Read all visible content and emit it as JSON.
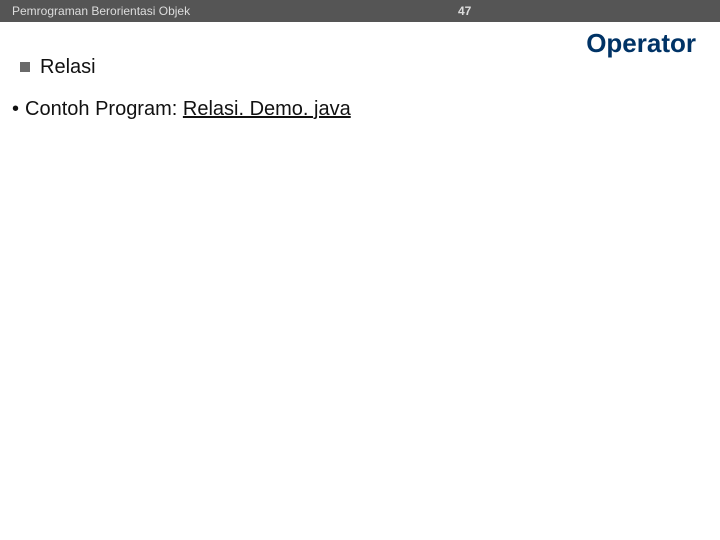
{
  "topbar": {
    "left": "Pemrograman Berorientasi Objek",
    "number": "47"
  },
  "title": "Operator",
  "subheading": "Relasi",
  "body": {
    "prefix": "Contoh Program: ",
    "link_text": "Relasi. Demo. java"
  }
}
